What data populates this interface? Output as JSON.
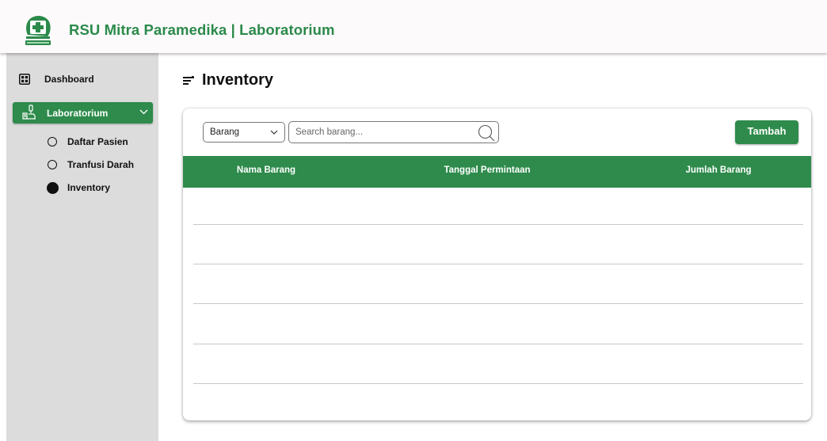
{
  "header": {
    "app_title": "RSU Mitra Paramedika | Laboratorium",
    "logo_icon": "hospital-cross-logo-icon"
  },
  "sidebar": {
    "items": [
      {
        "label": "Dashboard",
        "icon": "grid-icon",
        "active": false
      },
      {
        "label": "Laboratorium",
        "icon": "microscope-icon",
        "active": true,
        "expanded": true,
        "children": [
          {
            "label": "Daftar Pasien",
            "selected": false
          },
          {
            "label": "Tranfusi Darah",
            "selected": false
          },
          {
            "label": "Inventory",
            "selected": true
          }
        ]
      }
    ]
  },
  "page": {
    "title": "Inventory",
    "title_icon": "menu-lines-icon"
  },
  "toolbar": {
    "filter_value": "Barang",
    "search_placeholder": "Search barang...",
    "search_value": "",
    "add_label": "Tambah"
  },
  "table": {
    "columns": [
      "Nama Barang",
      "Tanggal Permintaan",
      "Jumlah Barang"
    ],
    "rows": []
  },
  "colors": {
    "primary_green": "#2e8b4b",
    "title_green": "#2b8a4a",
    "sidebar_bg": "#dcdcdc"
  }
}
